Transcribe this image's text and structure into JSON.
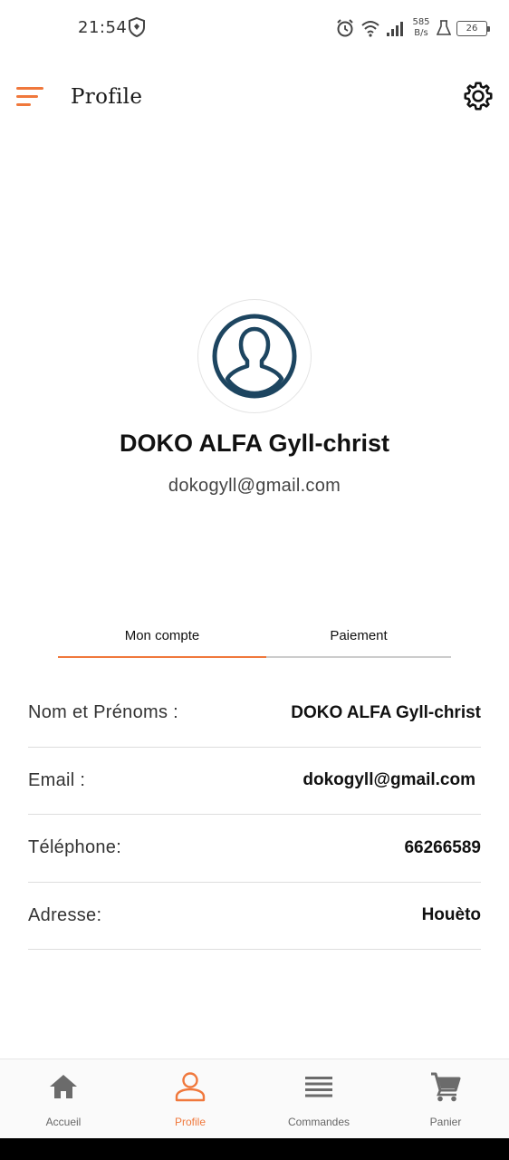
{
  "status_bar": {
    "time": "21:54",
    "net_speed_value": "585",
    "net_speed_unit": "B/s",
    "battery": "26"
  },
  "header": {
    "title": "Profile"
  },
  "profile": {
    "name": "DOKO ALFA Gyll-christ",
    "email": "dokogyll@gmail.com"
  },
  "tabs": [
    {
      "label": "Mon compte",
      "active": true
    },
    {
      "label": "Paiement",
      "active": false
    }
  ],
  "info_rows": [
    {
      "label": "Nom et Prénoms :",
      "value": "DOKO ALFA Gyll-christ"
    },
    {
      "label": "Email :",
      "value": "dokogyll@gmail.com"
    },
    {
      "label": "Téléphone:",
      "value": "66266589"
    },
    {
      "label": "Adresse:",
      "value": "Houèto"
    }
  ],
  "bottom_nav": [
    {
      "label": "Accueil",
      "icon": "home-icon",
      "active": false
    },
    {
      "label": "Profile",
      "icon": "user-icon",
      "active": true
    },
    {
      "label": "Commandes",
      "icon": "list-icon",
      "active": false
    },
    {
      "label": "Panier",
      "icon": "cart-icon",
      "active": false
    }
  ],
  "colors": {
    "accent": "#f0783c",
    "avatar": "#1d4560",
    "text": "#111111"
  }
}
